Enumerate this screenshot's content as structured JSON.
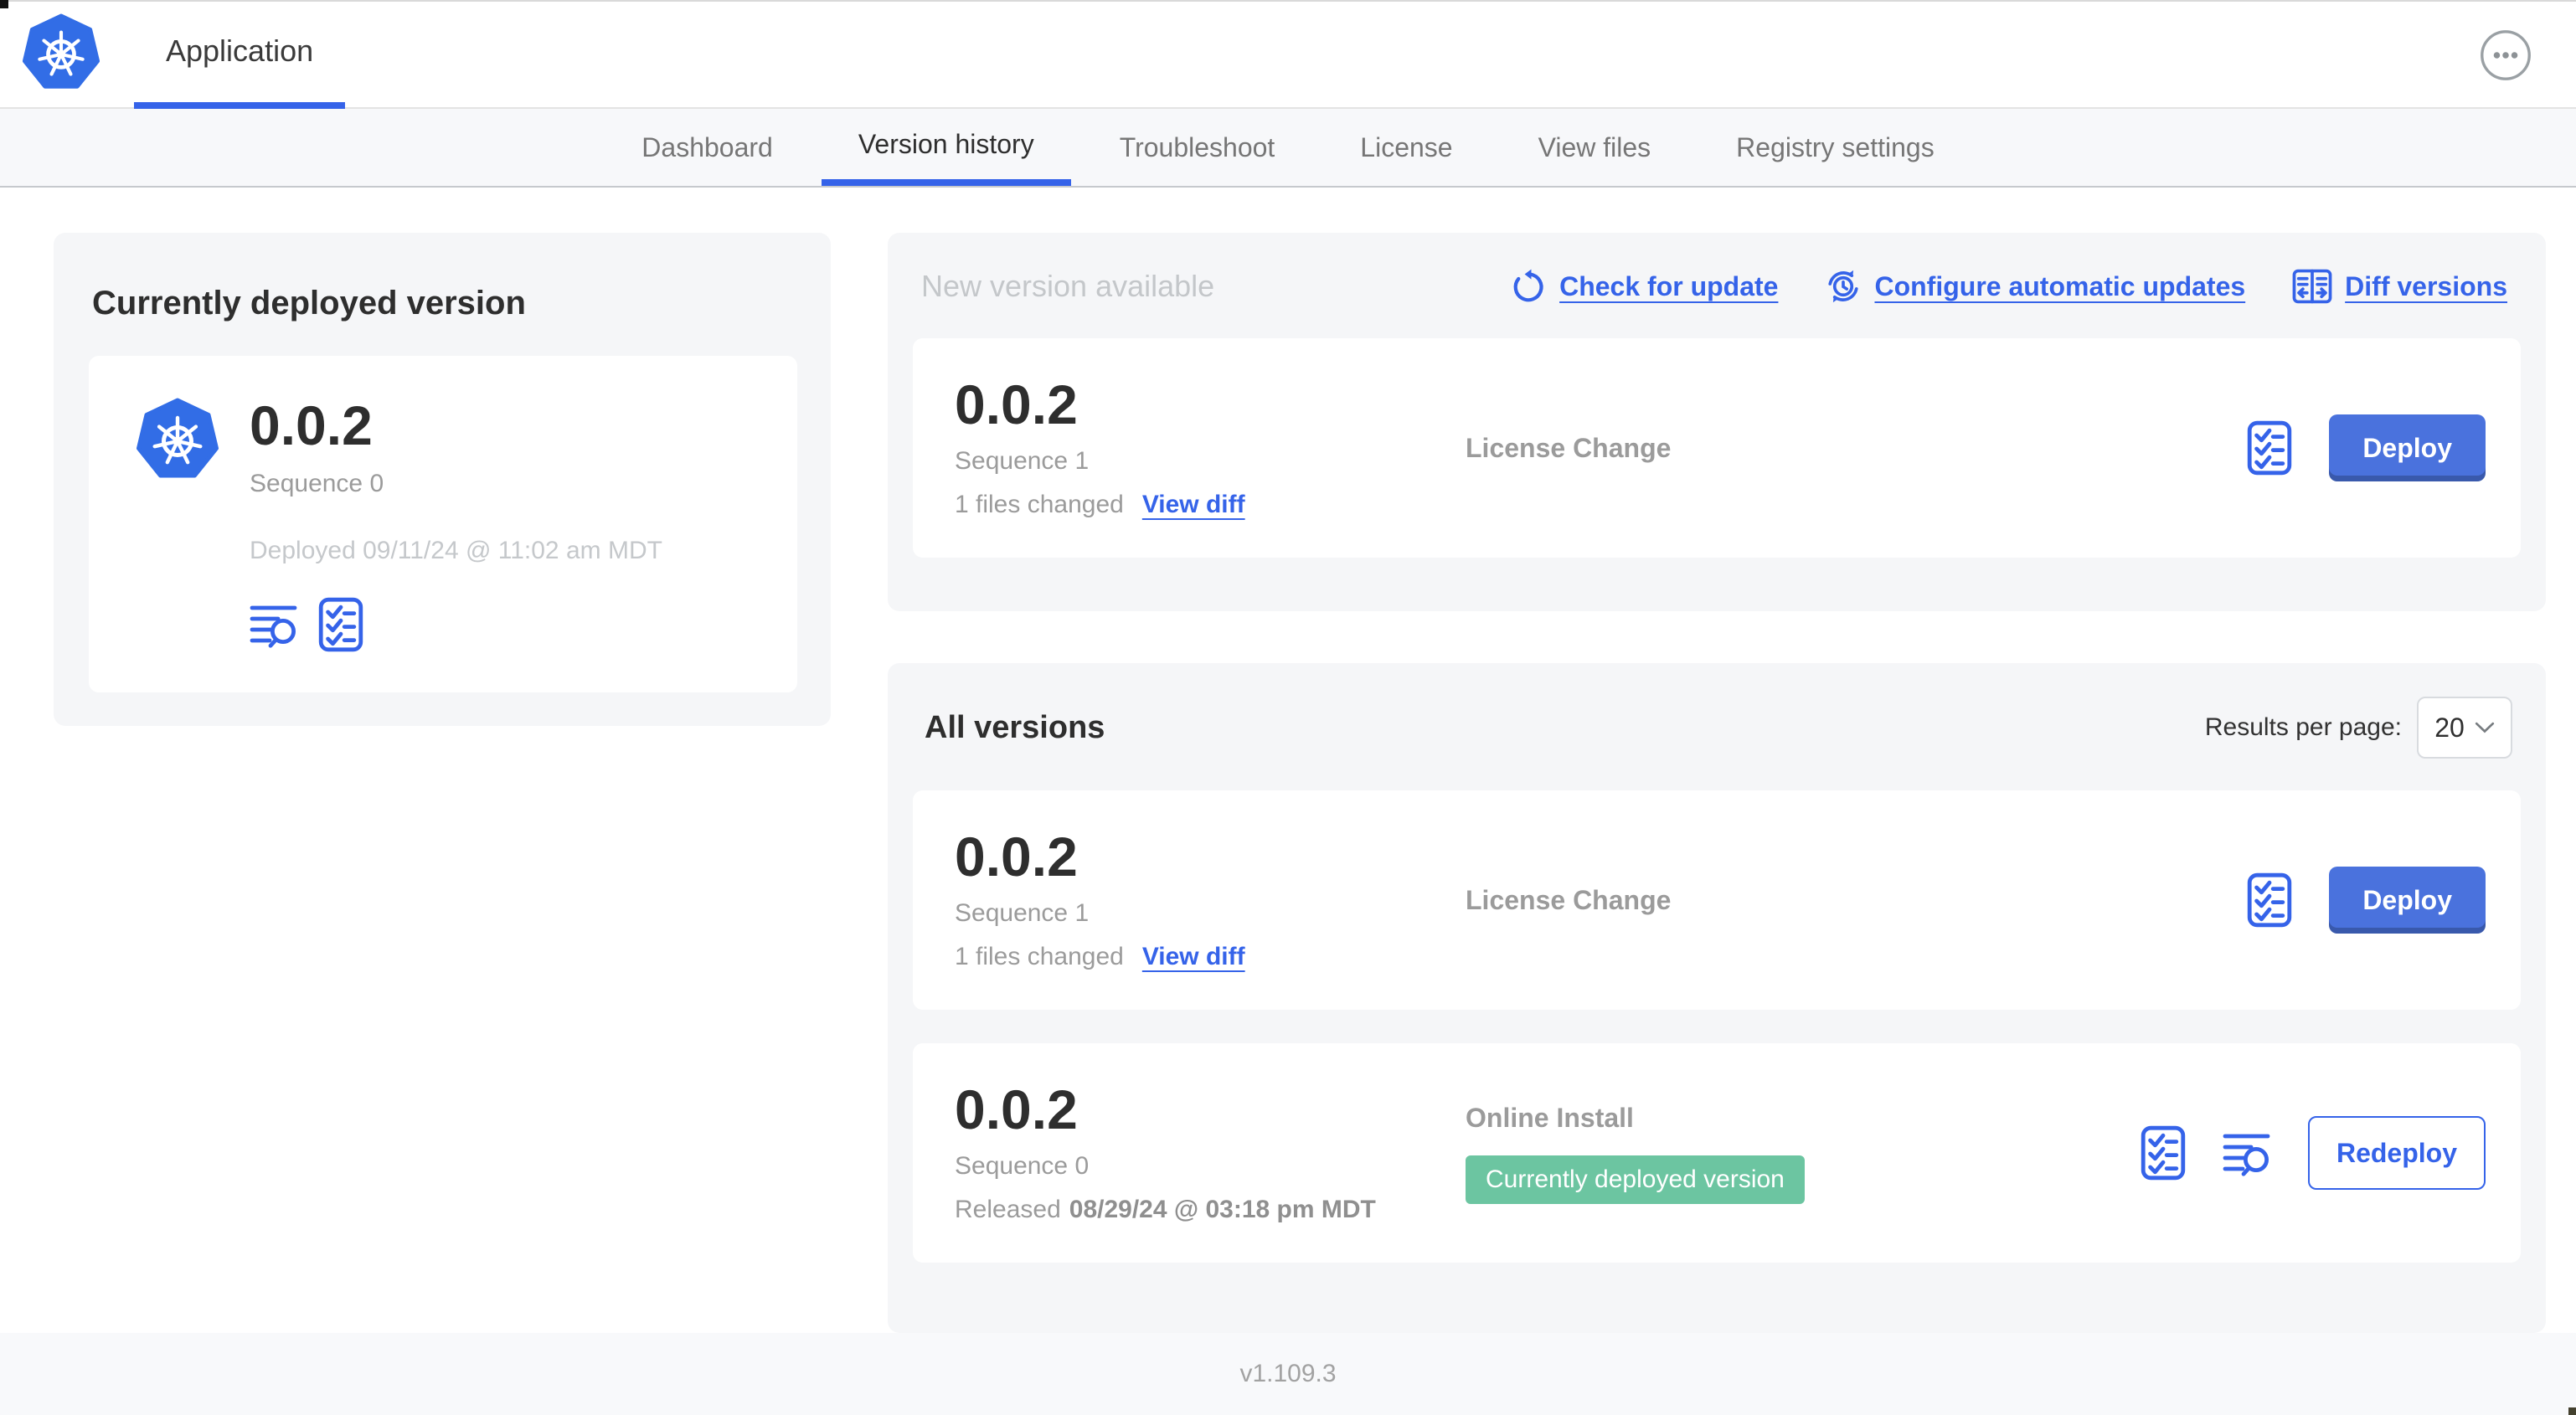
{
  "colors": {
    "accent_blue": "#3563e9",
    "logo_blue": "#326de6",
    "button_blue": "#4a72dd",
    "success_green": "#6cc5a1",
    "card_background": "#f5f6f8",
    "text_dark": "#2e2e2e",
    "text_gray": "#9b9b9b",
    "text_light_gray": "#c4c7ca"
  },
  "header": {
    "app_tab_label": "Application"
  },
  "nav": {
    "active_tab": "Version history",
    "tabs": [
      {
        "label": "Dashboard"
      },
      {
        "label": "Version history"
      },
      {
        "label": "Troubleshoot"
      },
      {
        "label": "License"
      },
      {
        "label": "View files"
      },
      {
        "label": "Registry settings"
      }
    ]
  },
  "current_version_card": {
    "title": "Currently deployed version",
    "version": "0.0.2",
    "sequence": "Sequence 0",
    "deployed": "Deployed 09/11/24 @ 11:02 am MDT"
  },
  "new_version_card": {
    "title": "New version available",
    "check_for_update_label": "Check for update",
    "configure_updates_label": "Configure automatic updates",
    "diff_versions_label": "Diff versions",
    "release": {
      "version": "0.0.2",
      "sequence": "Sequence 1",
      "files_changed": "1 files changed",
      "view_diff_label": "View diff",
      "source": "License Change",
      "action_label": "Deploy"
    }
  },
  "all_versions": {
    "title": "All versions",
    "results_per_page_label": "Results per page:",
    "results_per_page_value": "20",
    "rows": [
      {
        "version": "0.0.2",
        "sequence": "Sequence 1",
        "files_changed": "1 files changed",
        "view_diff_label": "View diff",
        "source": "License Change",
        "action_label": "Deploy"
      },
      {
        "version": "0.0.2",
        "sequence": "Sequence 0",
        "released_prefix": "Released",
        "released_date": "08/29/24 @ 03:18 pm MDT",
        "source": "Online Install",
        "badge": "Currently deployed version",
        "action_label": "Redeploy"
      }
    ]
  },
  "footer": {
    "app_version": "v1.109.3"
  }
}
